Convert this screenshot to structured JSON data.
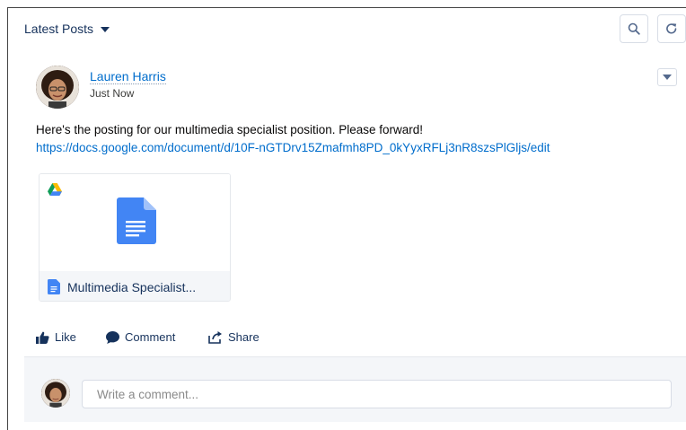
{
  "feed": {
    "filter_label": "Latest Posts",
    "toolbar": {
      "search_icon": "search-icon",
      "refresh_icon": "refresh-icon"
    }
  },
  "post": {
    "author": "Lauren Harris",
    "timestamp": "Just Now",
    "text": "Here's the posting for our multimedia specialist position. Please forward!",
    "link": "https://docs.google.com/document/d/10F-nGTDrv15Zmafmh8PD_0kYyxRFLj3nR8szsPlGljs/edit",
    "attachment": {
      "title": "Multimedia Specialist...",
      "source_icon": "google-drive-icon",
      "type_icon": "google-docs-icon"
    },
    "actions": {
      "like": "Like",
      "comment": "Comment",
      "share": "Share"
    }
  },
  "comment_box": {
    "placeholder": "Write a comment..."
  },
  "colors": {
    "link": "#006dcc",
    "text": "#16325c",
    "doc_blue": "#4285f4",
    "panel_bg": "#f4f6f9"
  }
}
